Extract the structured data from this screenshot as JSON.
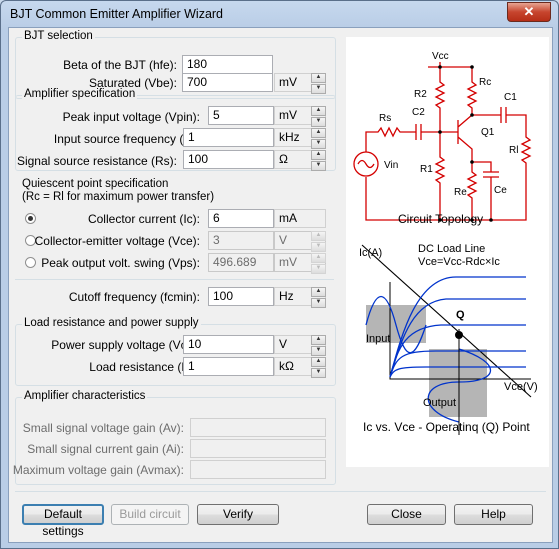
{
  "window": {
    "title": "BJT Common Emitter Amplifier Wizard",
    "close_glyph": "✕"
  },
  "bjt": {
    "group": "BJT selection",
    "hfe_label": "Beta of the BJT (hfe):",
    "hfe_value": "180",
    "vbe_label": "Saturated (Vbe):",
    "vbe_value": "700",
    "vbe_unit": "mV"
  },
  "amp": {
    "group": "Amplifier specification",
    "vpin_label": "Peak input voltage (Vpin):",
    "vpin_value": "5",
    "vpin_unit": "mV",
    "fs_label": "Input source frequency (fs):",
    "fs_value": "1",
    "fs_unit": "kHz",
    "rs_label": "Signal source resistance (Rs):",
    "rs_value": "100",
    "rs_unit": "Ω"
  },
  "qpoint": {
    "heading1": "Quiescent point specification",
    "heading2": "(Rc = Rl for maximum power transfer)",
    "ic_label": "Collector current (Ic):",
    "ic_value": "6",
    "ic_unit": "mA",
    "vce_label": "Collector-emitter voltage (Vce):",
    "vce_value": "3",
    "vce_unit": "V",
    "vps_label": "Peak output volt. swing (Vps):",
    "vps_value": "496.689",
    "vps_unit": "mV",
    "fcmin_label": "Cutoff frequency (fcmin):",
    "fcmin_value": "100",
    "fcmin_unit": "Hz"
  },
  "load": {
    "group": "Load resistance and power supply",
    "vcc_label": "Power supply voltage (Vcc):",
    "vcc_value": "10",
    "vcc_unit": "V",
    "rl_label": "Load resistance (Rl):",
    "rl_value": "1",
    "rl_unit": "kΩ"
  },
  "chars": {
    "group": "Amplifier characteristics",
    "av_label": "Small signal voltage gain (Av):",
    "ai_label": "Small signal current gain (Ai):",
    "avmax_label": "Maximum voltage gain (Avmax):"
  },
  "buttons": {
    "default": "Default settings",
    "build": "Build circuit",
    "verify": "Verify",
    "close": "Close",
    "help": "Help"
  },
  "circuit": {
    "caption": "Circuit Topology",
    "vcc": "Vcc",
    "r2": "R2",
    "rc": "Rc",
    "c1": "C1",
    "rs": "Rs",
    "c2": "C2",
    "q1": "Q1",
    "rl": "Rl",
    "vin": "Vin",
    "r1": "R1",
    "re": "Re",
    "ce": "Ce"
  },
  "graph": {
    "caption": "Ic vs. Vce - Operatinq (Q) Point",
    "ic_axis": "Ic(A)",
    "loadline1": "DC Load Line",
    "loadline2": "Vce=Vcc-Rdc×Ic",
    "q": "Q",
    "input": "Input",
    "output": "Output",
    "vce_axis": "Vce(V)"
  },
  "colors": {
    "wire": "#d40000",
    "curve": "#0033cc",
    "shade": "#b5b5b5"
  }
}
